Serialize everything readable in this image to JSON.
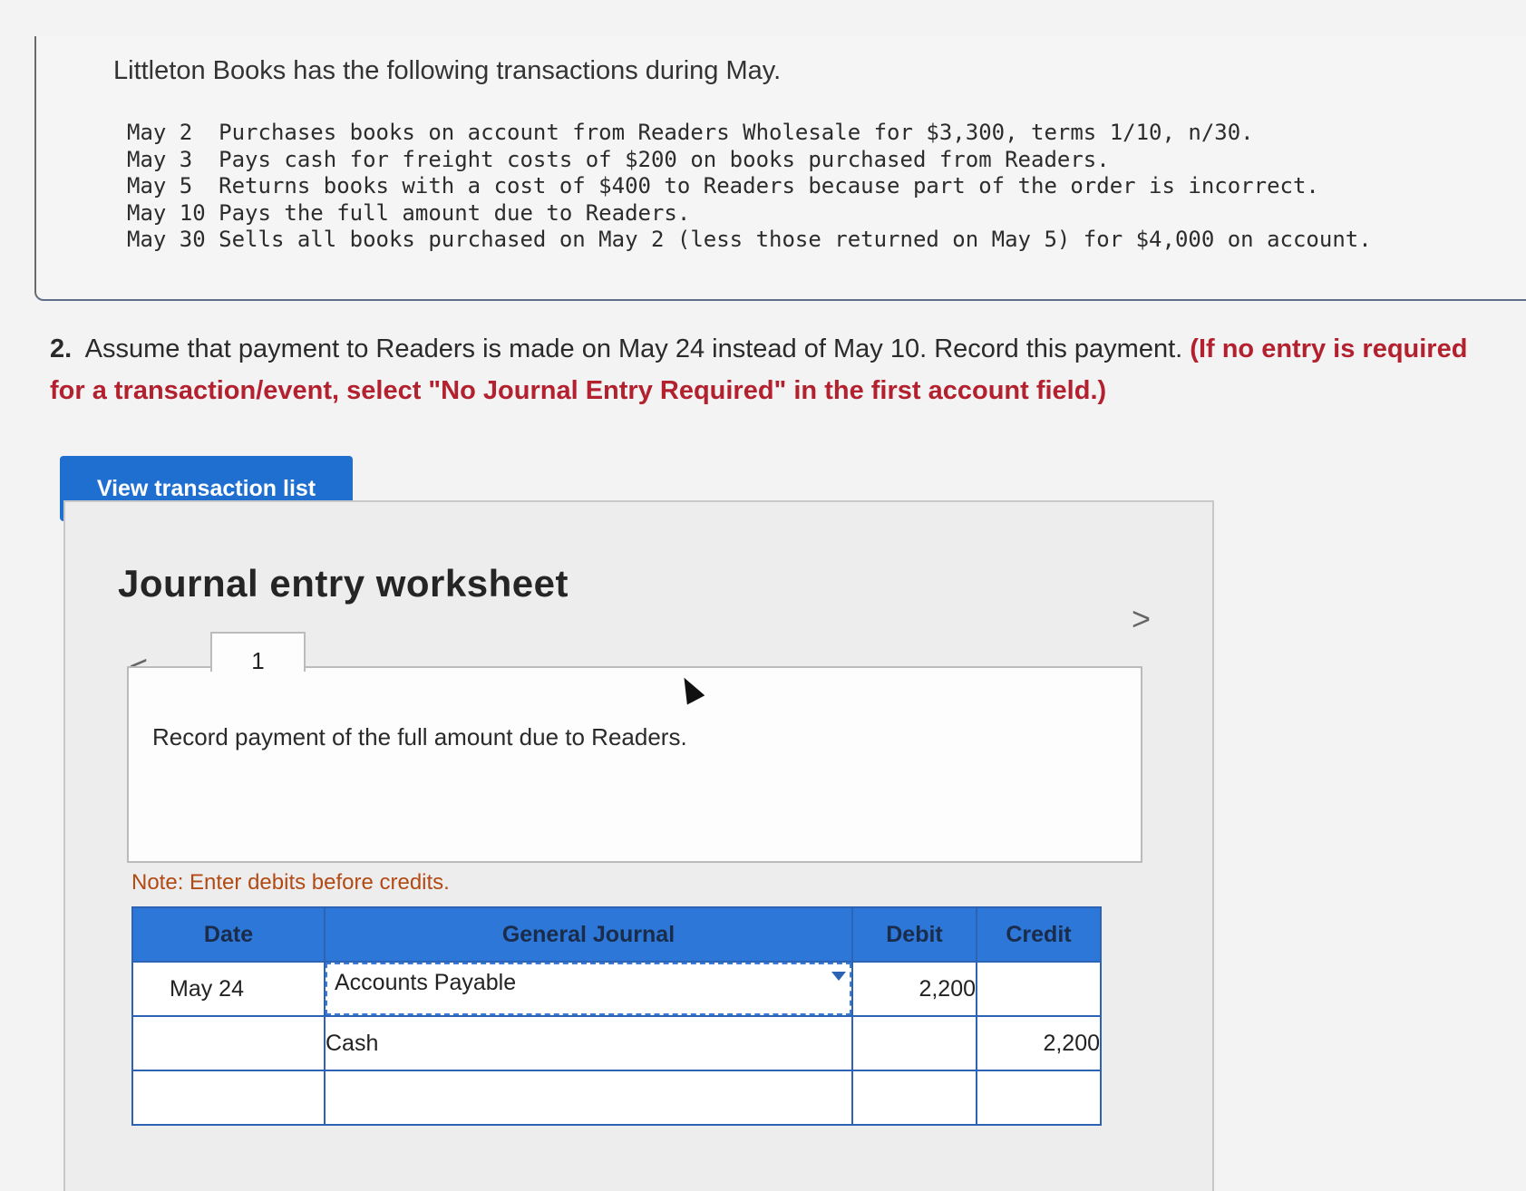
{
  "problem": {
    "intro": "Littleton Books has the following transactions during May.",
    "transactions": [
      "May 2  Purchases books on account from Readers Wholesale for $3,300, terms 1/10, n/30.",
      "May 3  Pays cash for freight costs of $200 on books purchased from Readers.",
      "May 5  Returns books with a cost of $400 to Readers because part of the order is incorrect.",
      "May 10 Pays the full amount due to Readers.",
      "May 30 Sells all books purchased on May 2 (less those returned on May 5) for $4,000 on account."
    ]
  },
  "question": {
    "number": "2.",
    "text": "Assume that payment to Readers is made on May 24 instead of May 10. Record this payment.",
    "instruction": "(If no entry is required for a transaction/event, select \"No Journal Entry Required\" in the first account field.)"
  },
  "view_button": "View transaction list",
  "worksheet": {
    "title": "Journal entry worksheet",
    "nav_prev": "<",
    "nav_next": ">",
    "tab": "1",
    "prompt": "Record payment of the full amount due to Readers.",
    "note": "Note: Enter debits before credits.",
    "headers": {
      "date": "Date",
      "journal": "General Journal",
      "debit": "Debit",
      "credit": "Credit"
    },
    "rows": [
      {
        "date": "May 24",
        "account": "Accounts Payable",
        "debit": "2,200",
        "credit": ""
      },
      {
        "date": "",
        "account": "Cash",
        "debit": "",
        "credit": "2,200"
      },
      {
        "date": "",
        "account": "",
        "debit": "",
        "credit": ""
      },
      {
        "date": "",
        "account": "",
        "debit": "",
        "credit": ""
      },
      {
        "date": "",
        "account": "",
        "debit": "",
        "credit": ""
      }
    ]
  },
  "colors": {
    "accent": "#1f6fd1",
    "header": "#2c77d8",
    "instruction": "#b3212f",
    "note": "#b24a14"
  }
}
